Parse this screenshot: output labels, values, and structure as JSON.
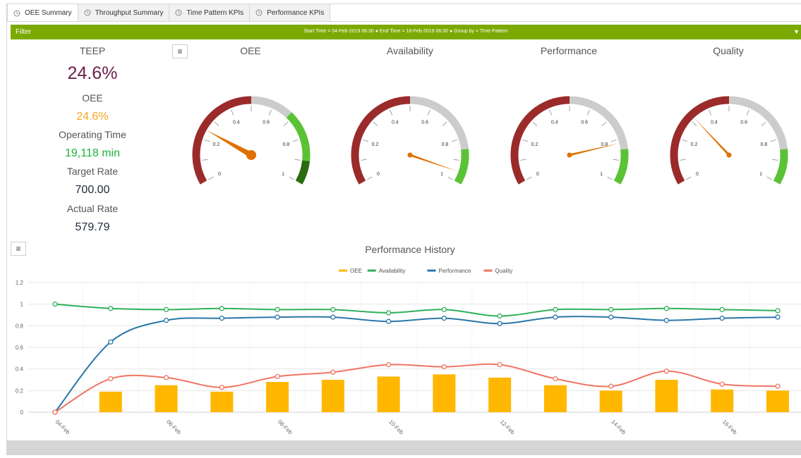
{
  "tabs": [
    {
      "label": "OEE Summary",
      "active": true
    },
    {
      "label": "Throughput Summary",
      "active": false
    },
    {
      "label": "Time Pattern KPIs",
      "active": false
    },
    {
      "label": "Performance KPIs",
      "active": false
    }
  ],
  "filter": {
    "label": "Filter",
    "info": "Start Time = 04-Feb-2019 06:30 ● End Time = 18-Feb-2019 06:30 ● Group by = Time Pattern"
  },
  "kpis": {
    "teep_label": "TEEP",
    "teep_value": "24.6%",
    "oee_label": "OEE",
    "oee_value": "24.6%",
    "operating_time_label": "Operating Time",
    "operating_time_value": "19,118 min",
    "target_rate_label": "Target Rate",
    "target_rate_value": "700.00",
    "actual_rate_label": "Actual Rate",
    "actual_rate_value": "579.79"
  },
  "colors": {
    "teep": "#6b1f4c",
    "oee": "#f5a623",
    "operating_time": "#1db33a",
    "rate": "#1e2b3a",
    "gauge_red": "#9b2b2b",
    "gauge_grey": "#cccccc",
    "gauge_green": "#5bc236",
    "gauge_dark_green": "#2a6b10",
    "needle": "#e07000",
    "bar": "#ffb700",
    "line_availability": "#2eb05b",
    "line_performance": "#2a77a8",
    "line_quality": "#f07562"
  },
  "gauges": [
    {
      "title": "OEE",
      "value": 0.246,
      "ticks": [
        "0",
        "0.2",
        "0.4",
        "0.6",
        "0.8",
        "1"
      ],
      "bands": [
        [
          0,
          0.5,
          "red"
        ],
        [
          0.5,
          0.68,
          "grey"
        ],
        [
          0.68,
          0.9,
          "green"
        ],
        [
          0.9,
          1,
          "darkgreen"
        ]
      ],
      "big_hub": true
    },
    {
      "title": "Availability",
      "value": 0.954,
      "ticks": [
        "0",
        "0.2",
        "0.4",
        "0.6",
        "0.8",
        "1"
      ],
      "bands": [
        [
          0,
          0.5,
          "red"
        ],
        [
          0.5,
          0.85,
          "grey"
        ],
        [
          0.85,
          1,
          "green"
        ]
      ],
      "big_hub": false
    },
    {
      "title": "Performance",
      "value": 0.82,
      "ticks": [
        "0",
        "0.2",
        "0.4",
        "0.6",
        "0.8",
        "1"
      ],
      "bands": [
        [
          0,
          0.5,
          "red"
        ],
        [
          0.5,
          0.85,
          "grey"
        ],
        [
          0.85,
          1,
          "green"
        ]
      ],
      "big_hub": false
    },
    {
      "title": "Quality",
      "value": 0.32,
      "ticks": [
        "0",
        "0.2",
        "0.4",
        "0.6",
        "0.8",
        "1"
      ],
      "bands": [
        [
          0,
          0.5,
          "red"
        ],
        [
          0.5,
          0.85,
          "grey"
        ],
        [
          0.85,
          1,
          "green"
        ]
      ],
      "big_hub": false
    }
  ],
  "chart_data": {
    "type": "bar",
    "title": "Performance History",
    "legend_position": "top-center",
    "ylim": [
      0,
      1.2
    ],
    "y_ticks": [
      "0",
      "0.2",
      "0.4",
      "0.6",
      "0.8",
      "1",
      "1.2"
    ],
    "x": [
      "04-Feb",
      "05-Feb",
      "06-Feb",
      "07-Feb",
      "08-Feb",
      "09-Feb",
      "10-Feb",
      "11-Feb",
      "12-Feb",
      "13-Feb",
      "14-Feb",
      "15-Feb",
      "16-Feb",
      "17-Feb"
    ],
    "x_tick_labels": [
      "04-Feb",
      "06-Feb",
      "08-Feb",
      "10-Feb",
      "12-Feb",
      "14-Feb",
      "16-Feb"
    ],
    "series": [
      {
        "name": "OEE",
        "kind": "bar",
        "values": [
          0,
          0.19,
          0.25,
          0.19,
          0.28,
          0.3,
          0.33,
          0.35,
          0.32,
          0.25,
          0.2,
          0.3,
          0.21,
          0.2
        ]
      },
      {
        "name": "Availability",
        "kind": "line",
        "values": [
          1.0,
          0.96,
          0.95,
          0.96,
          0.95,
          0.95,
          0.92,
          0.95,
          0.89,
          0.95,
          0.95,
          0.96,
          0.95,
          0.94
        ]
      },
      {
        "name": "Performance",
        "kind": "line",
        "values": [
          0,
          0.65,
          0.85,
          0.87,
          0.88,
          0.88,
          0.84,
          0.87,
          0.82,
          0.88,
          0.88,
          0.85,
          0.87,
          0.88
        ]
      },
      {
        "name": "Quality",
        "kind": "line",
        "values": [
          0,
          0.31,
          0.32,
          0.23,
          0.33,
          0.37,
          0.44,
          0.42,
          0.44,
          0.31,
          0.24,
          0.38,
          0.26,
          0.24
        ]
      }
    ]
  }
}
